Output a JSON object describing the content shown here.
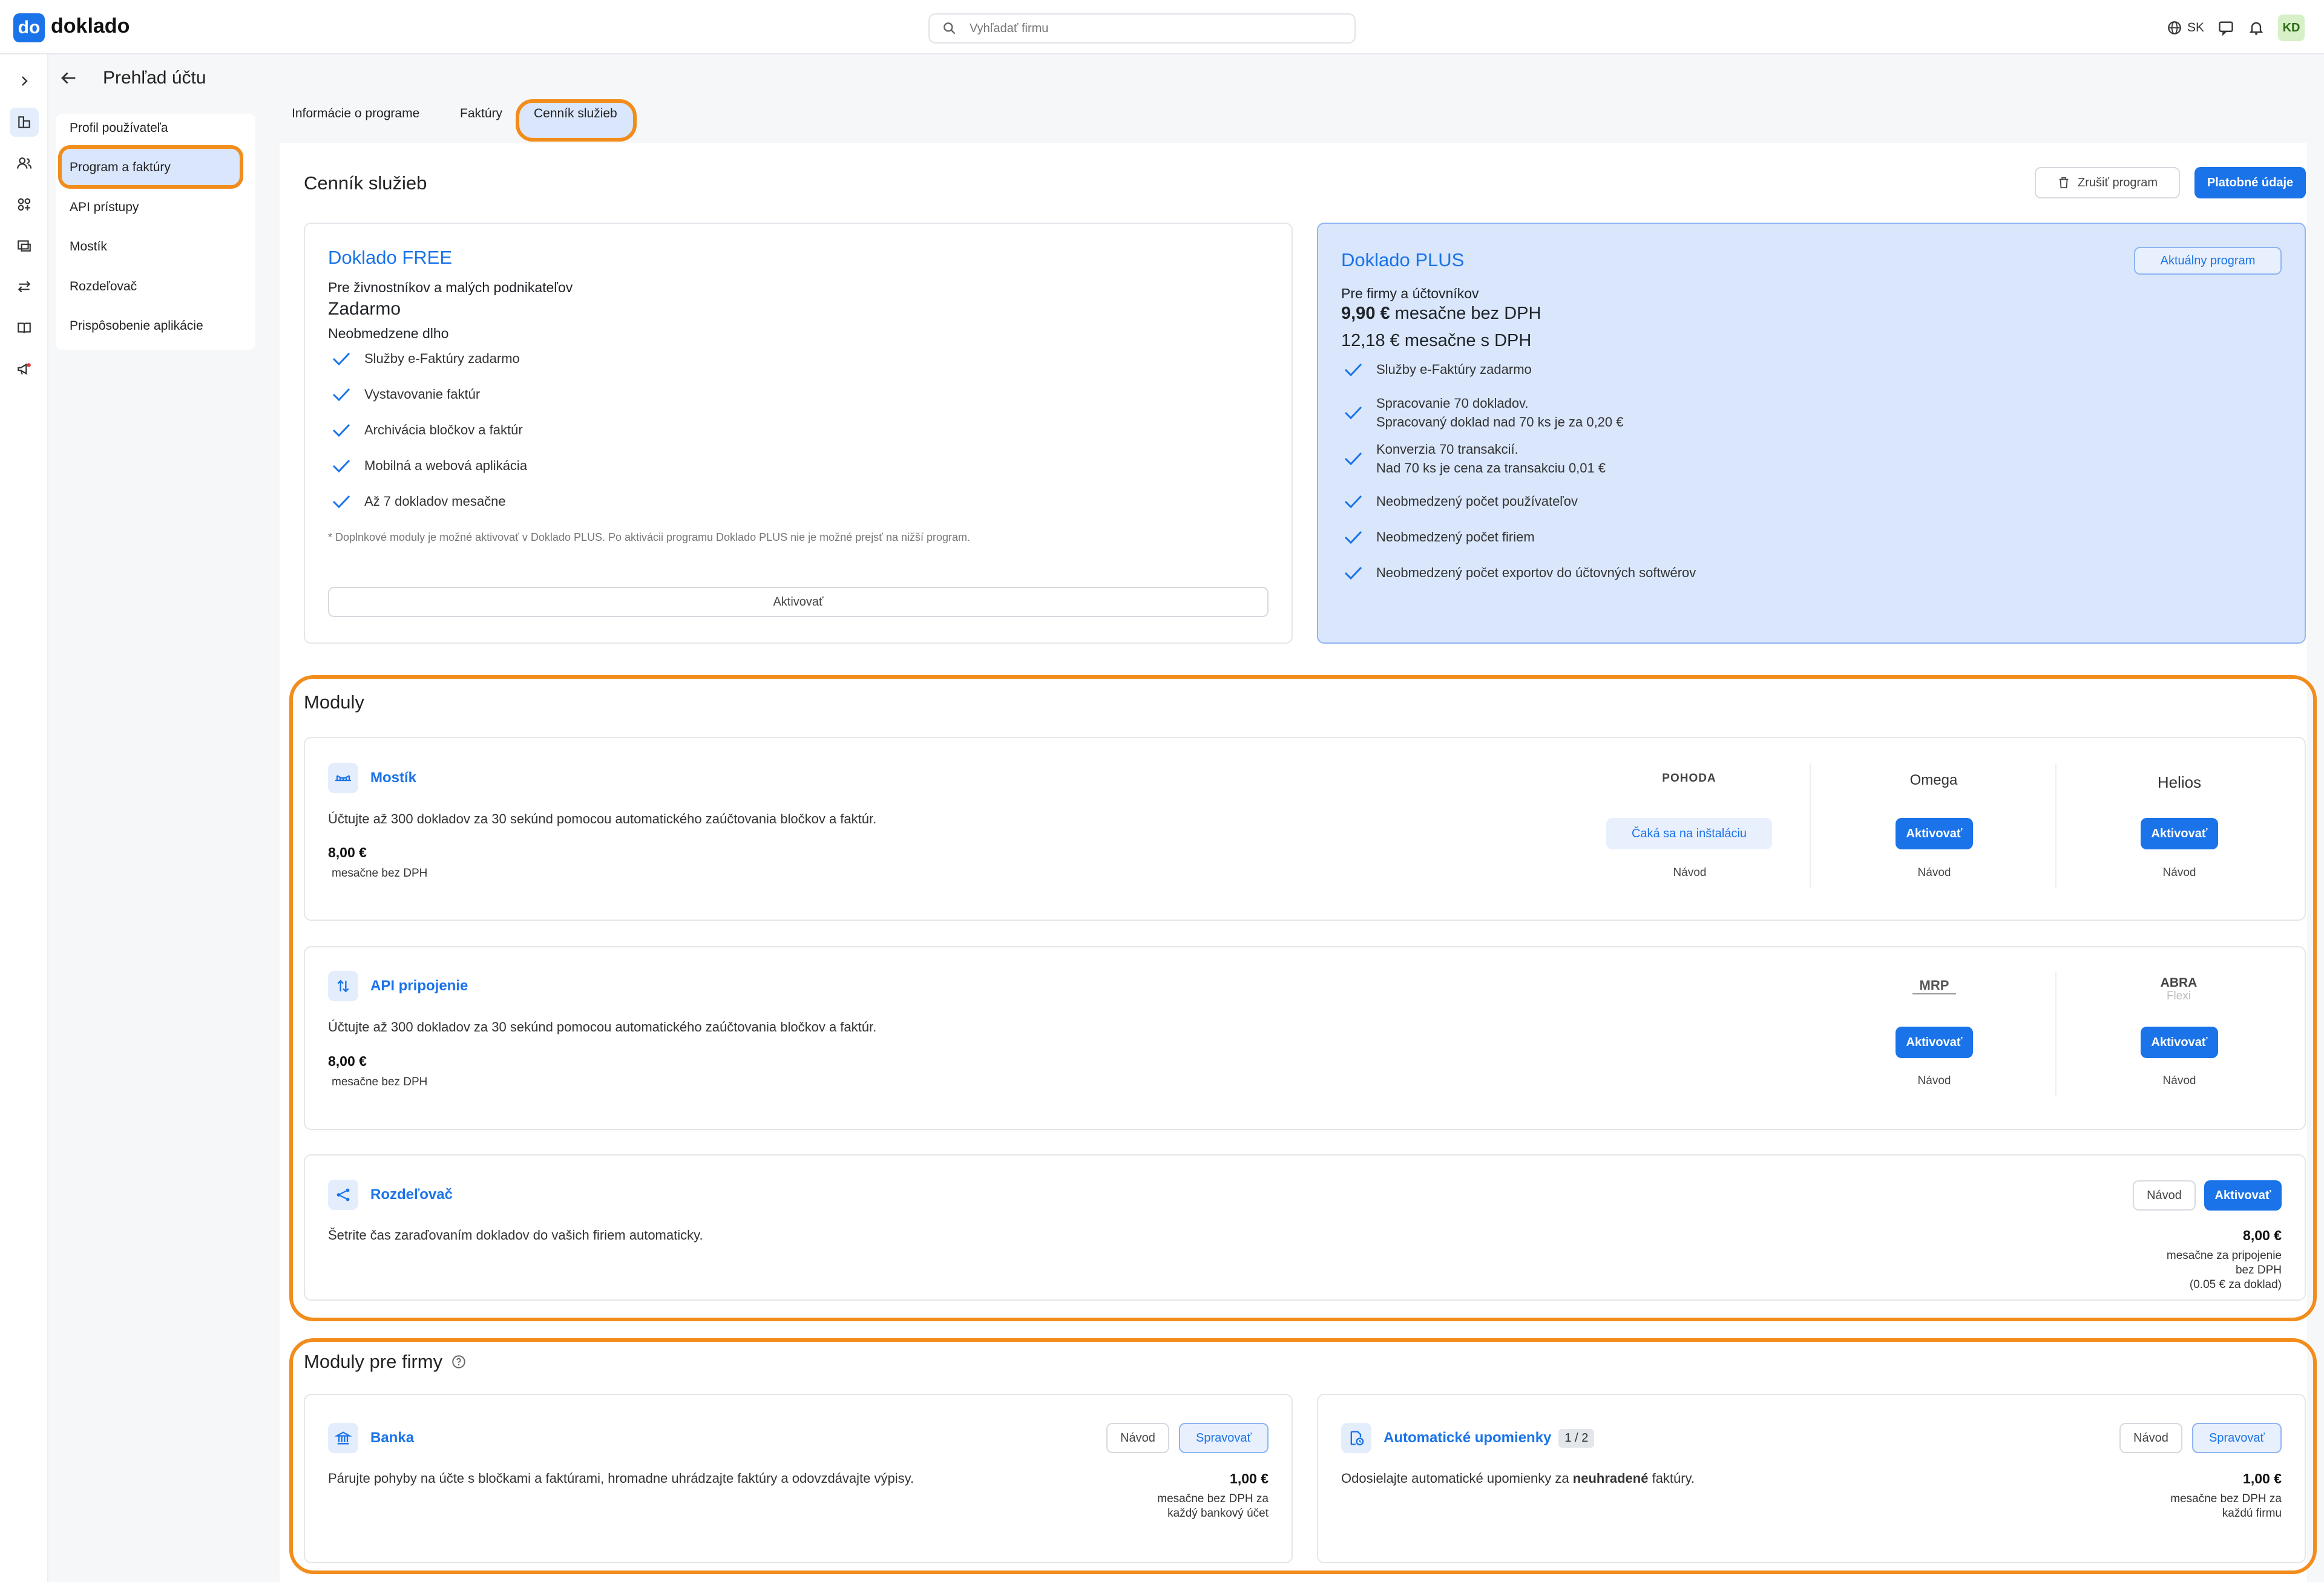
{
  "app": {
    "logo_mark": "do",
    "logo_text": "doklado"
  },
  "search": {
    "placeholder": "Vyhľadať firmu"
  },
  "topbar": {
    "lang": "SK",
    "avatar": "KD"
  },
  "header": {
    "title": "Prehľad účtu"
  },
  "sidemenu": {
    "items": [
      {
        "label": "Profil používateľa"
      },
      {
        "label": "Program a faktúry"
      },
      {
        "label": "API prístupy"
      },
      {
        "label": "Mostík"
      },
      {
        "label": "Rozdeľovač"
      },
      {
        "label": "Prispôsobenie aplikácie"
      }
    ]
  },
  "tabs": [
    {
      "label": "Informácie o programe"
    },
    {
      "label": "Faktúry"
    },
    {
      "label": "Cenník služieb"
    }
  ],
  "pricing": {
    "title": "Cenník služieb",
    "cancel_label": "Zrušiť program",
    "payment_label": "Platobné údaje",
    "free": {
      "name": "Doklado FREE",
      "audience": "Pre živnostníkov a malých podnikateľov",
      "price": "Zadarmo",
      "term": "Neobmedzene dlho",
      "features": [
        "Služby e-Faktúry zadarmo",
        "Vystavovanie faktúr",
        "Archivácia bločkov a faktúr",
        "Mobilná a webová aplikácia",
        "Až 7 dokladov mesačne"
      ],
      "note": "* Doplnkové moduly je možné aktivovať v Doklado PLUS. Po aktivácii programu Doklado PLUS nie je možné prejsť na nižší program.",
      "activate_label": "Aktivovať"
    },
    "plus": {
      "name": "Doklado PLUS",
      "badge": "Aktuálny program",
      "audience": "Pre firmy a účtovníkov",
      "price_amount": "9,90 €",
      "price_suffix": " mesačne bez DPH",
      "price_vat": "12,18 € mesačne s DPH",
      "features": [
        [
          "Služby e-Faktúry zadarmo"
        ],
        [
          "Spracovanie 70 dokladov.",
          "Spracovaný doklad nad 70 ks je za 0,20 €"
        ],
        [
          "Konverzia 70 transakcií.",
          "Nad 70 ks je cena za transakciu 0,01 €"
        ],
        [
          "Neobmedzený počet používateľov"
        ],
        [
          "Neobmedzený počet firiem"
        ],
        [
          "Neobmedzený počet exportov do účtovných softwérov"
        ]
      ]
    }
  },
  "modules": {
    "title": "Moduly",
    "mostik": {
      "name": "Mostík",
      "desc": "Účtujte až 300 dokladov za 30 sekúnd pomocou automatického zaúčtovania bločkov a faktúr.",
      "price": "8,00 €",
      "price_sub": "mesačne bez DPH",
      "integrations": [
        {
          "name": "POHODA",
          "action": "Čaká sa na inštaláciu",
          "guide": "Návod"
        },
        {
          "name": "Omega",
          "action": "Aktivovať",
          "guide": "Návod"
        },
        {
          "name": "Helios",
          "action": "Aktivovať",
          "guide": "Návod"
        }
      ]
    },
    "api": {
      "name": "API pripojenie",
      "desc": "Účtujte až 300 dokladov za 30 sekúnd pomocou automatického zaúčtovania bločkov a faktúr.",
      "price": "8,00 €",
      "price_sub": "mesačne bez DPH",
      "integrations": [
        {
          "name": "MRP",
          "action": "Aktivovať",
          "guide": "Návod"
        },
        {
          "name": "ABRA",
          "name2": "Flexi",
          "action": "Aktivovať",
          "guide": "Návod"
        }
      ]
    },
    "rozdelovac": {
      "name": "Rozdeľovač",
      "desc": "Šetrite čas zaraďovaním dokladov do vašich firiem automaticky.",
      "guide": "Návod",
      "action": "Aktivovať",
      "price": "8,00 €",
      "price_lines": [
        "mesačne za pripojenie",
        "bez DPH",
        "(0.05 € za doklad)"
      ]
    }
  },
  "company_modules": {
    "title": "Moduly pre firmy",
    "banka": {
      "name": "Banka",
      "desc": "Párujte pohyby na účte s bločkami a faktúrami, hromadne uhrádzajte faktúry a odovzdávajte výpisy.",
      "guide": "Návod",
      "manage": "Spravovať",
      "price": "1,00 €",
      "price_lines": [
        "mesačne bez DPH za",
        "každý bankový účet"
      ]
    },
    "upomienky": {
      "name": "Automatické upomienky",
      "badge": "1 / 2",
      "desc_pre": "Odosielajte automatické upomienky za ",
      "desc_bold": "neuhradené",
      "desc_post": " faktúry.",
      "guide": "Návod",
      "manage": "Spravovať",
      "price": "1,00 €",
      "price_lines": [
        "mesačne bez DPH za",
        "každú firmu"
      ]
    }
  },
  "colors": {
    "accent": "#1a73e8",
    "highlight": "#f28c1b",
    "plus_bg": "#d9e6fb"
  }
}
